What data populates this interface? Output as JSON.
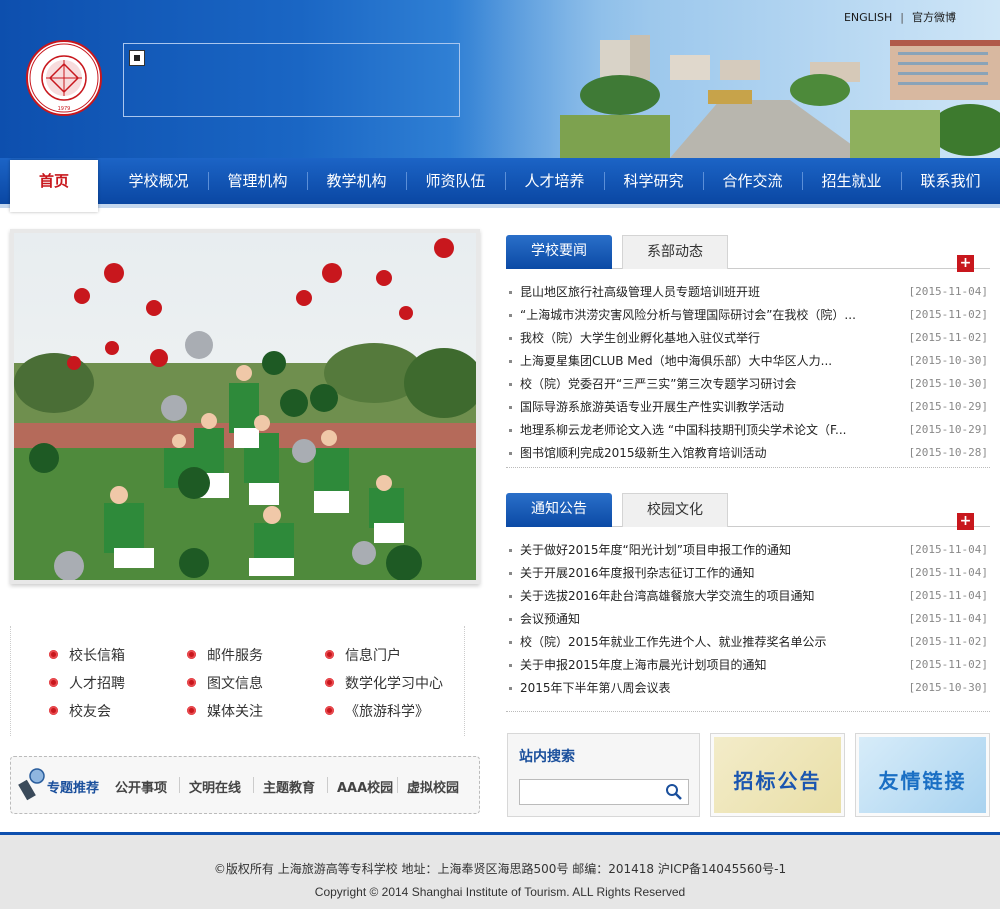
{
  "header": {
    "logo_text": "SHANGHAI INSTITUTE OF TOURISM",
    "logo_year": "1979",
    "top_links": [
      "ENGLISH",
      "官方微博"
    ]
  },
  "nav": {
    "items": [
      "首页",
      "学校概况",
      "管理机构",
      "教学机构",
      "师资队伍",
      "人才培养",
      "科学研究",
      "合作交流",
      "招生就业",
      "联系我们"
    ]
  },
  "news": {
    "tabs": [
      "学校要闻",
      "系部动态"
    ],
    "items": [
      {
        "title": "昆山地区旅行社高级管理人员专题培训班开班",
        "date": "[2015-11-04]"
      },
      {
        "title": "“上海城市洪涝灾害风险分析与管理国际研讨会”在我校（院）...",
        "date": "[2015-11-02]"
      },
      {
        "title": "我校（院）大学生创业孵化基地入驻仪式举行",
        "date": "[2015-11-02]"
      },
      {
        "title": "上海夏星集团CLUB Med（地中海俱乐部）大中华区人力...",
        "date": "[2015-10-30]"
      },
      {
        "title": "校（院）党委召开“三严三实”第三次专题学习研讨会",
        "date": "[2015-10-30]"
      },
      {
        "title": "国际导游系旅游英语专业开展生产性实训教学活动",
        "date": "[2015-10-29]"
      },
      {
        "title": "地理系柳云龙老师论文入选 “中国科技期刊顶尖学术论文（F...",
        "date": "[2015-10-29]"
      },
      {
        "title": "图书馆顺利完成2015级新生入馆教育培训活动",
        "date": "[2015-10-28]"
      }
    ]
  },
  "notice": {
    "tabs": [
      "通知公告",
      "校园文化"
    ],
    "items": [
      {
        "title": "关于做好2015年度“阳光计划”项目申报工作的通知",
        "date": "[2015-11-04]"
      },
      {
        "title": "关于开展2016年度报刊杂志征订工作的通知",
        "date": "[2015-11-04]"
      },
      {
        "title": "关于选拔2016年赴台湾高雄餐旅大学交流生的项目通知",
        "date": "[2015-11-04]"
      },
      {
        "title": "会议预通知",
        "date": "[2015-11-04]"
      },
      {
        "title": "校（院）2015年就业工作先进个人、就业推荐奖名单公示",
        "date": "[2015-11-02]"
      },
      {
        "title": "关于申报2015年度上海市晨光计划项目的通知",
        "date": "[2015-11-02]"
      },
      {
        "title": "2015年下半年第八周会议表",
        "date": "[2015-10-30]"
      }
    ]
  },
  "plus_label": "+",
  "quick_links": [
    "校长信箱",
    "邮件服务",
    "信息门户",
    "人才招聘",
    "图文信息",
    "数学化学习中心",
    "校友会",
    "媒体关注",
    "《旅游科学》"
  ],
  "topics": {
    "title": "专题推荐",
    "links": [
      "公开事项",
      "文明在线",
      "主题教育",
      "AAA校园",
      "虚拟校园"
    ]
  },
  "search": {
    "title": "站内搜索",
    "placeholder": ""
  },
  "banners": [
    "招标公告",
    "友情链接"
  ],
  "footer": {
    "line1": "©版权所有 上海旅游高等专科学校 地址：上海奉贤区海思路500号 邮编：201418 沪ICP备14045560号-1",
    "line2": "Copyright © 2014 Shanghai Institute of Tourism. ALL Rights Reserved"
  },
  "colors": {
    "brand_blue": "#0d4fae",
    "accent_red": "#c8171d"
  }
}
